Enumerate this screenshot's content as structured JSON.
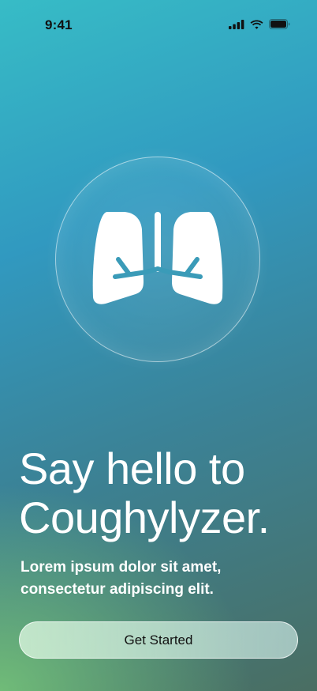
{
  "status_bar": {
    "time": "9:41",
    "icons": [
      "cellular-signal-icon",
      "wifi-icon",
      "battery-icon"
    ]
  },
  "hero": {
    "icon": "lungs-icon"
  },
  "headline_line1": "Say hello to",
  "headline_line2": "Coughylyzer.",
  "subtitle_line1": "Lorem ipsum dolor sit amet,",
  "subtitle_line2": "consectetur adipiscing elit.",
  "cta": {
    "label": "Get Started"
  },
  "colors": {
    "gradient_top": "#37bcc6",
    "gradient_mid": "#3199c0",
    "gradient_bottom": "#4a6e62",
    "glow_green": "#78c878",
    "icon_fill": "#ffffff",
    "icon_stroke": "#3a9bb8"
  }
}
